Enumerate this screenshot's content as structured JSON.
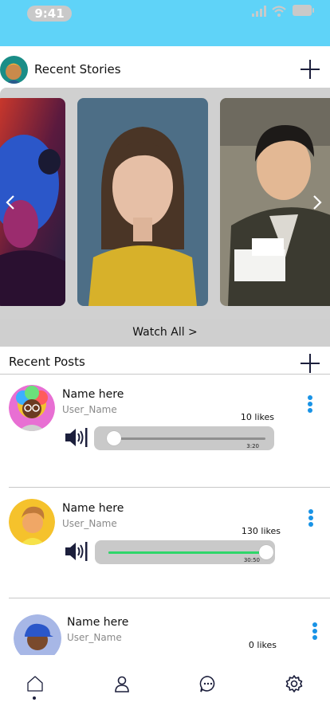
{
  "status_bar": {
    "time": "9:41"
  },
  "stories": {
    "title": "Recent Stories",
    "watch_all": "Watch All >"
  },
  "posts": {
    "title": "Recent Posts",
    "items": [
      {
        "name": "Name here",
        "user": "User_Name",
        "likes": "10 likes",
        "duration": "3:20",
        "progress": 0.04
      },
      {
        "name": "Name here",
        "user": "User_Name",
        "likes": "130 likes",
        "duration": "30:50",
        "progress": 1.0
      },
      {
        "name": "Name here",
        "user": "User_Name",
        "likes": "0 likes"
      }
    ]
  },
  "colors": {
    "status_bar": "#5fd3f8",
    "kebab": "#1993e6",
    "progress": "#2fd66a",
    "navy": "#1c1f3c"
  },
  "icons": [
    "plus-icon",
    "chevron-left-icon",
    "chevron-right-icon",
    "speaker-icon",
    "more-vertical-icon",
    "home-icon",
    "profile-icon",
    "chat-icon",
    "settings-icon"
  ]
}
